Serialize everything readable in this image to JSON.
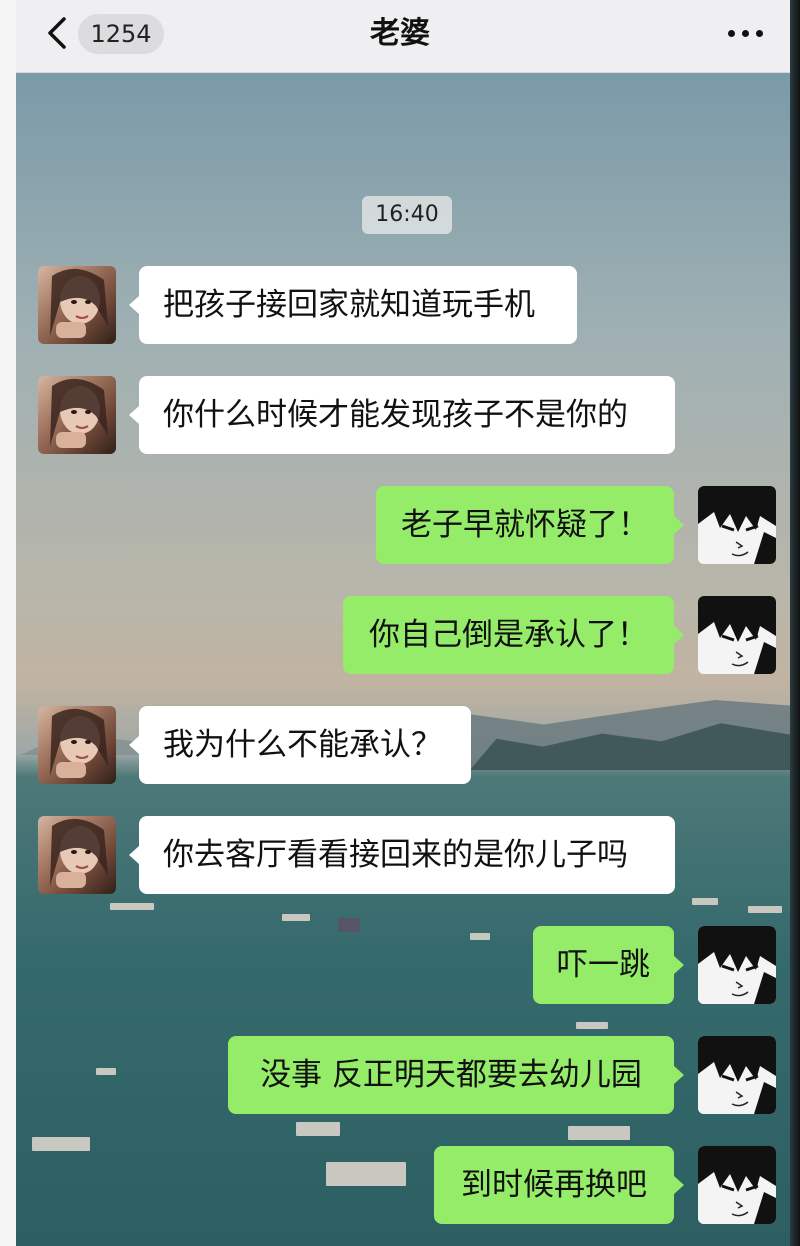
{
  "header": {
    "unread_count": "1254",
    "title": "老婆",
    "back_icon": "chevron-left-icon",
    "more_icon": "more-dots-icon"
  },
  "chat": {
    "timestamp": "16:40",
    "messages": [
      {
        "sender": "her",
        "text": "把孩子接回家就知道玩手机"
      },
      {
        "sender": "her",
        "text": "你什么时候才能发现孩子不是你的"
      },
      {
        "sender": "me",
        "text": "老子早就怀疑了！"
      },
      {
        "sender": "me",
        "text": "你自己倒是承认了！"
      },
      {
        "sender": "her",
        "text": "我为什么不能承认？"
      },
      {
        "sender": "her",
        "text": "你去客厅看看接回来的是你儿子吗"
      },
      {
        "sender": "me",
        "text": "吓一跳"
      },
      {
        "sender": "me",
        "text": "没事 反正明天都要去幼儿园"
      },
      {
        "sender": "me",
        "text": "到时候再换吧"
      }
    ]
  },
  "colors": {
    "nav_bg": "#efeff1",
    "received_bubble": "#ffffff",
    "sent_bubble": "#95ec69"
  }
}
